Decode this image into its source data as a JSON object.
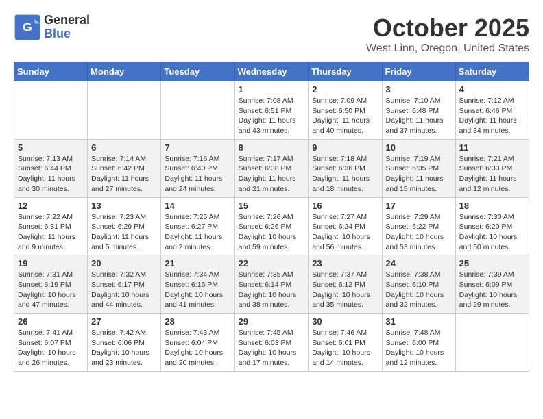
{
  "logo": {
    "general": "General",
    "blue": "Blue"
  },
  "title": "October 2025",
  "location": "West Linn, Oregon, United States",
  "days_of_week": [
    "Sunday",
    "Monday",
    "Tuesday",
    "Wednesday",
    "Thursday",
    "Friday",
    "Saturday"
  ],
  "weeks": [
    [
      {
        "day": "",
        "info": ""
      },
      {
        "day": "",
        "info": ""
      },
      {
        "day": "",
        "info": ""
      },
      {
        "day": "1",
        "info": "Sunrise: 7:08 AM\nSunset: 6:51 PM\nDaylight: 11 hours\nand 43 minutes."
      },
      {
        "day": "2",
        "info": "Sunrise: 7:09 AM\nSunset: 6:50 PM\nDaylight: 11 hours\nand 40 minutes."
      },
      {
        "day": "3",
        "info": "Sunrise: 7:10 AM\nSunset: 6:48 PM\nDaylight: 11 hours\nand 37 minutes."
      },
      {
        "day": "4",
        "info": "Sunrise: 7:12 AM\nSunset: 6:46 PM\nDaylight: 11 hours\nand 34 minutes."
      }
    ],
    [
      {
        "day": "5",
        "info": "Sunrise: 7:13 AM\nSunset: 6:44 PM\nDaylight: 11 hours\nand 30 minutes."
      },
      {
        "day": "6",
        "info": "Sunrise: 7:14 AM\nSunset: 6:42 PM\nDaylight: 11 hours\nand 27 minutes."
      },
      {
        "day": "7",
        "info": "Sunrise: 7:16 AM\nSunset: 6:40 PM\nDaylight: 11 hours\nand 24 minutes."
      },
      {
        "day": "8",
        "info": "Sunrise: 7:17 AM\nSunset: 6:38 PM\nDaylight: 11 hours\nand 21 minutes."
      },
      {
        "day": "9",
        "info": "Sunrise: 7:18 AM\nSunset: 6:36 PM\nDaylight: 11 hours\nand 18 minutes."
      },
      {
        "day": "10",
        "info": "Sunrise: 7:19 AM\nSunset: 6:35 PM\nDaylight: 11 hours\nand 15 minutes."
      },
      {
        "day": "11",
        "info": "Sunrise: 7:21 AM\nSunset: 6:33 PM\nDaylight: 11 hours\nand 12 minutes."
      }
    ],
    [
      {
        "day": "12",
        "info": "Sunrise: 7:22 AM\nSunset: 6:31 PM\nDaylight: 11 hours\nand 9 minutes."
      },
      {
        "day": "13",
        "info": "Sunrise: 7:23 AM\nSunset: 6:29 PM\nDaylight: 11 hours\nand 5 minutes."
      },
      {
        "day": "14",
        "info": "Sunrise: 7:25 AM\nSunset: 6:27 PM\nDaylight: 11 hours\nand 2 minutes."
      },
      {
        "day": "15",
        "info": "Sunrise: 7:26 AM\nSunset: 6:26 PM\nDaylight: 10 hours\nand 59 minutes."
      },
      {
        "day": "16",
        "info": "Sunrise: 7:27 AM\nSunset: 6:24 PM\nDaylight: 10 hours\nand 56 minutes."
      },
      {
        "day": "17",
        "info": "Sunrise: 7:29 AM\nSunset: 6:22 PM\nDaylight: 10 hours\nand 53 minutes."
      },
      {
        "day": "18",
        "info": "Sunrise: 7:30 AM\nSunset: 6:20 PM\nDaylight: 10 hours\nand 50 minutes."
      }
    ],
    [
      {
        "day": "19",
        "info": "Sunrise: 7:31 AM\nSunset: 6:19 PM\nDaylight: 10 hours\nand 47 minutes."
      },
      {
        "day": "20",
        "info": "Sunrise: 7:32 AM\nSunset: 6:17 PM\nDaylight: 10 hours\nand 44 minutes."
      },
      {
        "day": "21",
        "info": "Sunrise: 7:34 AM\nSunset: 6:15 PM\nDaylight: 10 hours\nand 41 minutes."
      },
      {
        "day": "22",
        "info": "Sunrise: 7:35 AM\nSunset: 6:14 PM\nDaylight: 10 hours\nand 38 minutes."
      },
      {
        "day": "23",
        "info": "Sunrise: 7:37 AM\nSunset: 6:12 PM\nDaylight: 10 hours\nand 35 minutes."
      },
      {
        "day": "24",
        "info": "Sunrise: 7:38 AM\nSunset: 6:10 PM\nDaylight: 10 hours\nand 32 minutes."
      },
      {
        "day": "25",
        "info": "Sunrise: 7:39 AM\nSunset: 6:09 PM\nDaylight: 10 hours\nand 29 minutes."
      }
    ],
    [
      {
        "day": "26",
        "info": "Sunrise: 7:41 AM\nSunset: 6:07 PM\nDaylight: 10 hours\nand 26 minutes."
      },
      {
        "day": "27",
        "info": "Sunrise: 7:42 AM\nSunset: 6:06 PM\nDaylight: 10 hours\nand 23 minutes."
      },
      {
        "day": "28",
        "info": "Sunrise: 7:43 AM\nSunset: 6:04 PM\nDaylight: 10 hours\nand 20 minutes."
      },
      {
        "day": "29",
        "info": "Sunrise: 7:45 AM\nSunset: 6:03 PM\nDaylight: 10 hours\nand 17 minutes."
      },
      {
        "day": "30",
        "info": "Sunrise: 7:46 AM\nSunset: 6:01 PM\nDaylight: 10 hours\nand 14 minutes."
      },
      {
        "day": "31",
        "info": "Sunrise: 7:48 AM\nSunset: 6:00 PM\nDaylight: 10 hours\nand 12 minutes."
      },
      {
        "day": "",
        "info": ""
      }
    ]
  ]
}
